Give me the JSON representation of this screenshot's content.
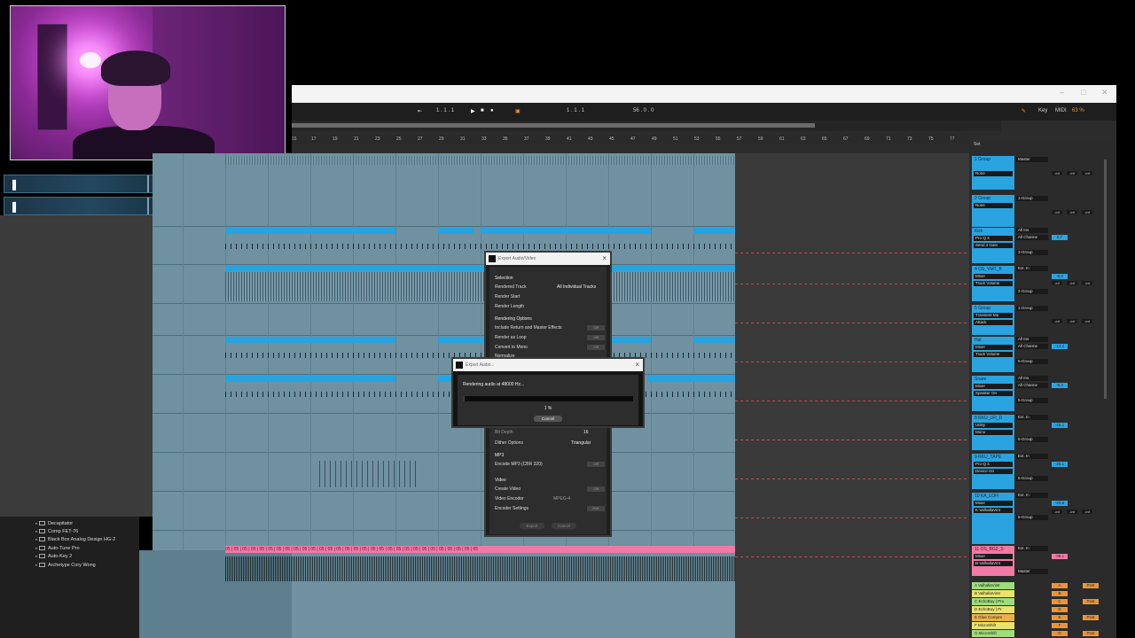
{
  "webcam": {
    "label": ""
  },
  "stream_bars": [
    {
      "left_icon": "❚",
      "right_icon": "★"
    },
    {
      "left_icon": "❚",
      "right_icon": "ʃ"
    }
  ],
  "window": {
    "controls": [
      "–",
      "□",
      "✕"
    ]
  },
  "transport": {
    "position_left": "1 . 1 . 1",
    "position_right": "1 . 1 . 1",
    "loop_length": "56 . 0 . 0",
    "key_label": "Key",
    "midi_label": "MIDI",
    "cpu": "63 %"
  },
  "ruler": [
    "15",
    "17",
    "19",
    "21",
    "23",
    "25",
    "27",
    "29",
    "31",
    "33",
    "35",
    "37",
    "39",
    "41",
    "43",
    "45",
    "47",
    "49",
    "51",
    "53",
    "55",
    "57",
    "59",
    "61",
    "63",
    "65",
    "67",
    "69",
    "71",
    "73",
    "75",
    "77"
  ],
  "browser": {
    "items": [
      "Decapitator",
      "Comp FET-76",
      "Black Box Analog Design HG-2",
      "Auto-Tune Pro",
      "Auto-Key 2",
      "Archetype Cory Wong"
    ]
  },
  "mixer": {
    "set_label": "Set",
    "tracks": [
      {
        "name": "1 Group",
        "device": "None",
        "io": "Master",
        "vol": ""
      },
      {
        "name": "2 Group",
        "device": "None",
        "io": "1-Group",
        "vol": ""
      },
      {
        "name": "Kick",
        "device": "Pro-Q 4",
        "device2": "Send 4 Gain",
        "io": "All Ins",
        "io2": "All Channe",
        "io3": "3-Group",
        "vol": "0.7"
      },
      {
        "name": "4 OS_VMT_B",
        "device": "Mixer",
        "device2": "Track Volume",
        "io": "Ext. In",
        "io2": "2-Group",
        "vol": "-5.3"
      },
      {
        "name": "5 Group",
        "device": "Transient Ma",
        "device2": "Attack",
        "io": "1-Group",
        "vol": ""
      },
      {
        "name": "Hat",
        "device": "Mixer",
        "device2": "Track Volume",
        "io": "All Ins",
        "io2": "All Channe",
        "io3": "5-Group",
        "vol": "-13.2"
      },
      {
        "name": "Snare",
        "device": "Mixer",
        "device2": "Speaker On",
        "io": "All Ins",
        "io2": "All Channe",
        "io3": "5-Group",
        "vol": "-6.3"
      },
      {
        "name": "8 RKU_LFI_D",
        "device": "Utility",
        "device2": "Mono",
        "io": "Ext. In",
        "io2": "5-Group",
        "vol": "-15.1"
      },
      {
        "name": "9 RKU_TAPE",
        "device": "Pro-Q 4",
        "device2": "Device On",
        "io": "Ext. In",
        "io2": "5-Group",
        "vol": "-25.1"
      },
      {
        "name": "10 KA_LOFI",
        "device": "Mixer",
        "device2": "K-ValhallaVint",
        "io": "Ext. In",
        "io2": "5-Group",
        "vol": "-20.6"
      },
      {
        "name": "11 OS_BG2_S",
        "device": "Mixer",
        "device2": "B-ValhallaVint",
        "io": "Ext. In",
        "io2": "Master",
        "vol": "-35.1"
      }
    ],
    "returns": [
      {
        "name": "A ValhallaVintr",
        "letter": "A"
      },
      {
        "name": "B ValhallaVintr",
        "letter": "B"
      },
      {
        "name": "C EchoBoy | Pro",
        "letter": "C"
      },
      {
        "name": "D EchoBoy | Pr",
        "letter": "D"
      },
      {
        "name": "E Glue Compre",
        "letter": "E"
      },
      {
        "name": "F MicroShift",
        "letter": "F"
      },
      {
        "name": "G MicroShift",
        "letter": "G"
      }
    ],
    "inf": "-inf",
    "post": "Post"
  },
  "pink_clip_text": "05 | 05 | 05 | 05 | 05 | 05 | 05 | 05 | 05 | 05 | 05 | 05 | 05 | 05 | 05 | 05 | 05 | 05 | 05 | 05 | 05 | 05 | 05 | 05 | 05 | 05 | 05 | 05 | 05 | 05",
  "export_dialog": {
    "title": "Export Audio/Video",
    "selection_header": "Selection",
    "rendered_track_label": "Rendered Track",
    "rendered_track_value": "All Individual Tracks",
    "render_start_label": "Render Start",
    "render_length_label": "Render Length",
    "rendering_options_header": "Rendering Options",
    "include_return_label": "Include Return and Master Effects",
    "render_loop_label": "Render as Loop",
    "convert_mono_label": "Convert to Mono",
    "normalize_label": "Normalize",
    "bit_depth_label": "Bit Depth",
    "bit_depth_value": "16",
    "dither_label": "Dither Options",
    "dither_value": "Triangular",
    "mp3_header": "MP3",
    "encode_mp3_label": "Encode MP3 (CBR 320)",
    "video_header": "Video",
    "create_video_label": "Create Video",
    "video_encoder_label": "Video Encoder",
    "video_encoder_value": "MPEG-4",
    "encoder_settings_label": "Encoder Settings",
    "encoder_settings_btn": "Edit",
    "off": "Off",
    "export_btn": "Export",
    "cancel_btn": "Cancel"
  },
  "progress_dialog": {
    "title": "Export Audio...",
    "message": "Rendering audio at 48000 Hz...",
    "percent": "1 %",
    "progress": 0.01,
    "cancel": "Cancel"
  }
}
